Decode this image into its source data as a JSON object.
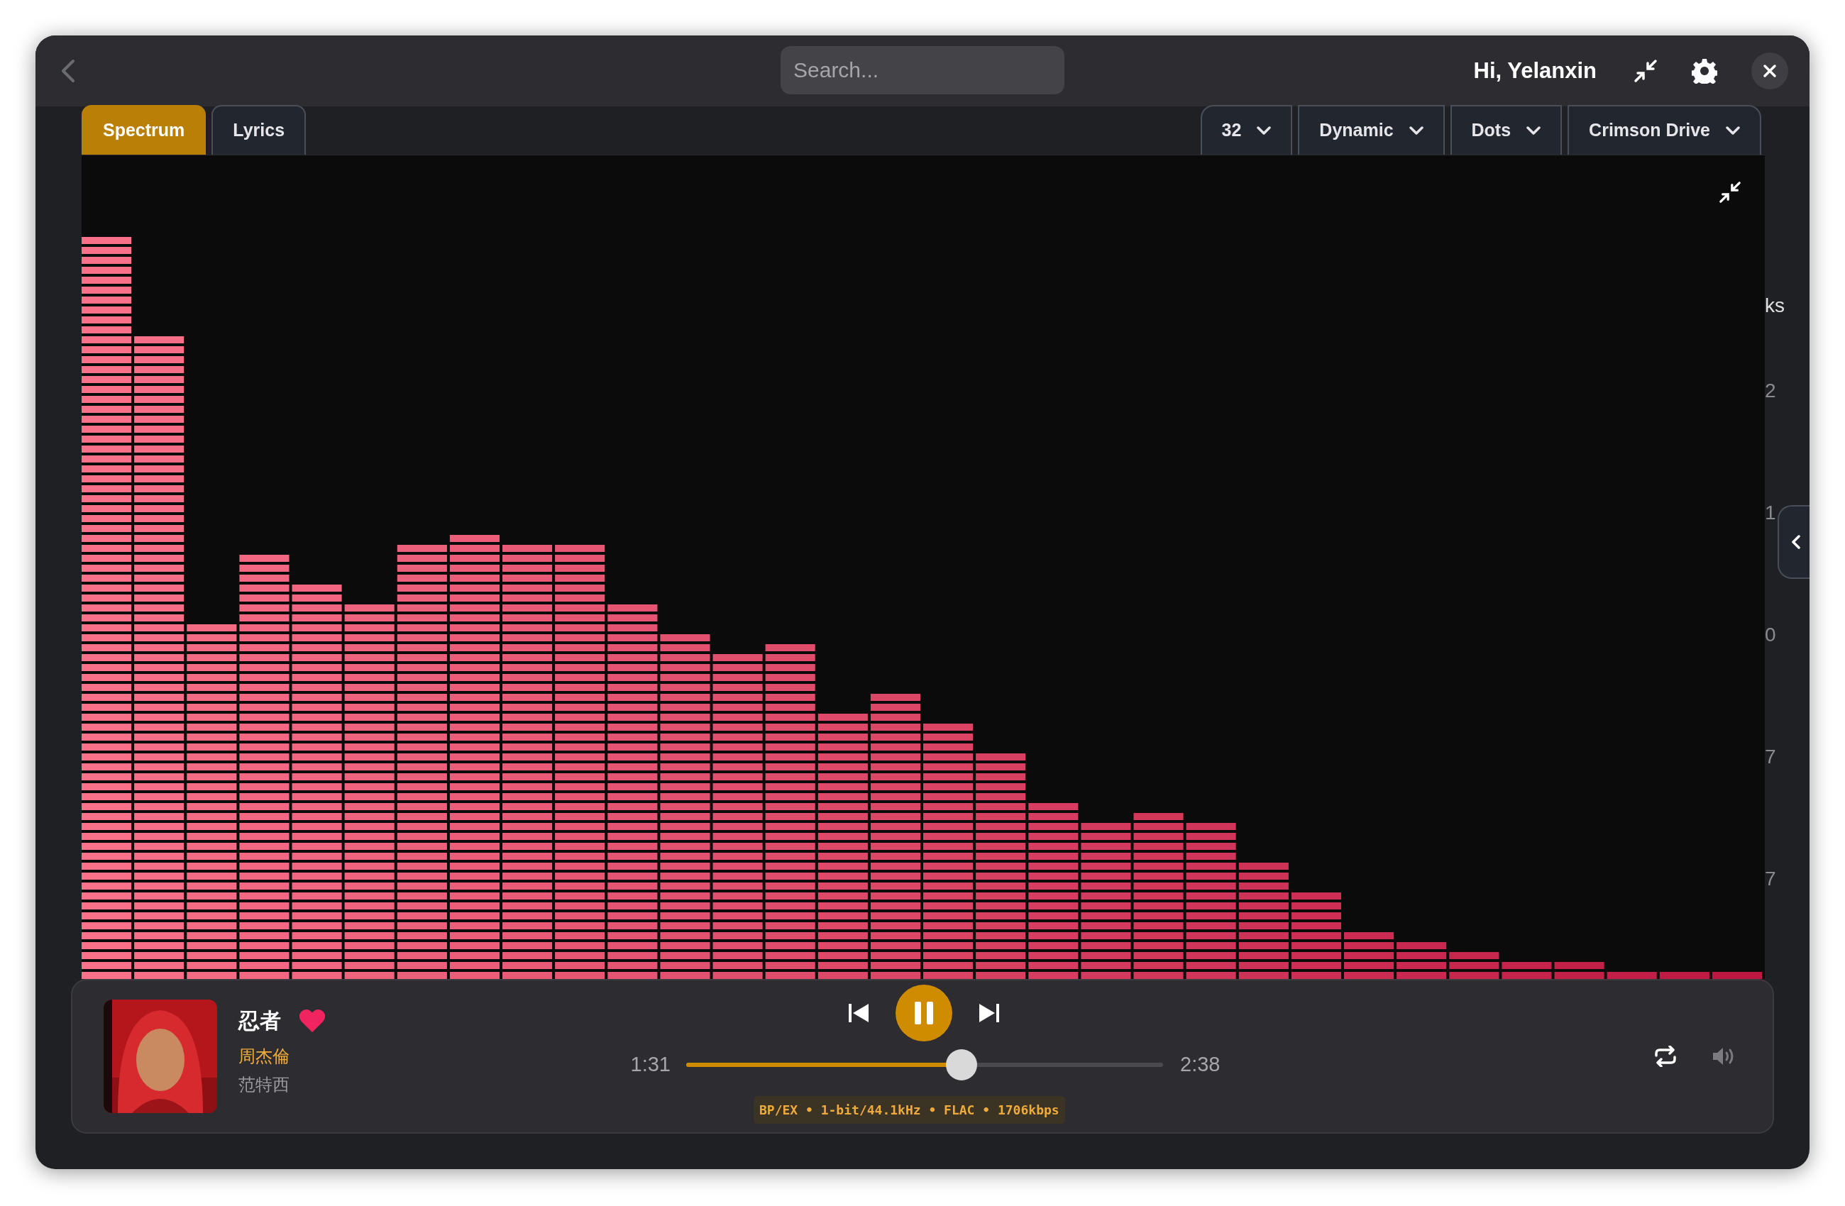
{
  "header": {
    "search": {
      "placeholder": "Search..."
    },
    "greeting": "Hi, Yelanxin"
  },
  "view_tabs": [
    {
      "label": "Spectrum",
      "selected": true
    },
    {
      "label": "Lyrics",
      "selected": false
    }
  ],
  "dropdowns": [
    {
      "label": "32"
    },
    {
      "label": "Dynamic"
    },
    {
      "label": "Dots"
    },
    {
      "label": "Crimson Drive"
    }
  ],
  "background_peek": {
    "track_count_fragment": "ks",
    "play_count_fragments": [
      "2",
      "1",
      "0",
      "7",
      "7"
    ]
  },
  "now_playing": {
    "title": "忍者",
    "liked": true,
    "artist": "周杰倫",
    "album": "范特西",
    "playing": true,
    "elapsed": "1:31",
    "duration": "2:38",
    "level": 0.577,
    "format": "BP/EX • 1-bit/44.1kHz • FLAC • 1706kbps"
  }
}
